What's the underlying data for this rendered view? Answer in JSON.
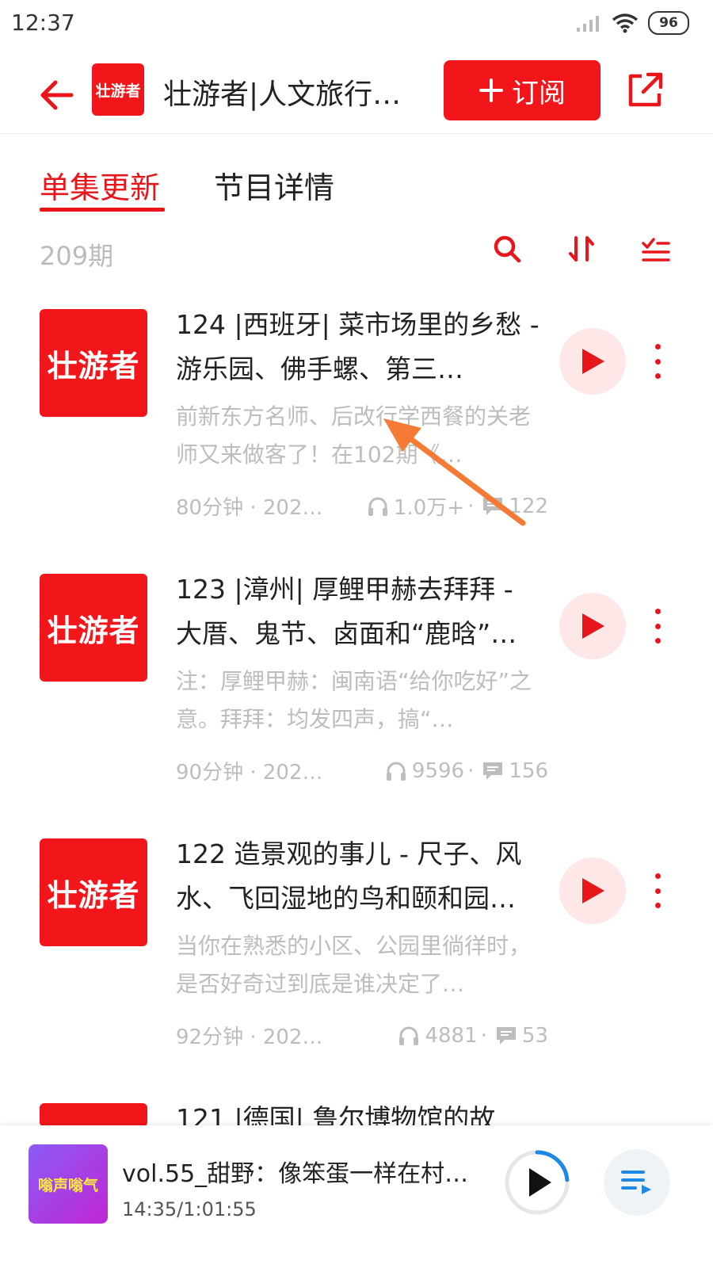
{
  "status_bar": {
    "time": "12:37",
    "battery": "96",
    "icons": [
      "signal-icon",
      "wifi-icon",
      "battery-icon"
    ]
  },
  "header": {
    "back_icon": "back-arrow-icon",
    "logo_text": "壮游者",
    "title": "壮游者|人文旅行…",
    "subscribe_label": "订阅",
    "subscribe_icon": "plus-icon",
    "share_icon": "share-icon"
  },
  "tabs": [
    {
      "label": "单集更新",
      "active": true
    },
    {
      "label": "节目详情",
      "active": false
    }
  ],
  "toolbar": {
    "episode_count": "209期",
    "icons": [
      "search-icon",
      "sort-icon",
      "batch-select-icon"
    ]
  },
  "episodes": [
    {
      "cover_text": "壮游者",
      "title": "124 |西班牙| 菜市场里的乡愁 - 游乐园、佛手螺、第三…",
      "desc": "前新东方名师、后改行学西餐的关老师又来做客了！在102期《…",
      "duration": "80分钟 · 2022…",
      "plays": "1.0万+",
      "comments": "122"
    },
    {
      "cover_text": "壮游者",
      "title": "123 |漳州| 厚鲤甲赫去拜拜 - 大厝、鬼节、卤面和“鹿晗”…",
      "desc": "注：厚鲤甲赫：闽南语“给你吃好”之意。拜拜：均发四声，搞“…",
      "duration": "90分钟 · 2022/…",
      "plays": "9596",
      "comments": "156"
    },
    {
      "cover_text": "壮游者",
      "title": "122 造景观的事儿 - 尺子、风水、飞回湿地的鸟和颐和园…",
      "desc": "当你在熟悉的小区、公园里徜徉时，是否好奇过到底是谁决定了…",
      "duration": "92分钟 · 2022/0…",
      "plays": "4881",
      "comments": "53"
    },
    {
      "cover_text": "壮游者",
      "title": "121 |德国| 鲁尔博物馆的故",
      "desc": "",
      "duration": "",
      "plays": "",
      "comments": ""
    }
  ],
  "player": {
    "cover_text": "嗡声嗡气",
    "title": "vol.55_甜野：像笨蛋一样在村…",
    "time": "14:35/1:01:55",
    "progress": 0.236,
    "play_icon": "play-icon",
    "list_icon": "playlist-icon"
  },
  "colors": {
    "accent": "#e8161b",
    "annotation_arrow": "#f47a35"
  }
}
